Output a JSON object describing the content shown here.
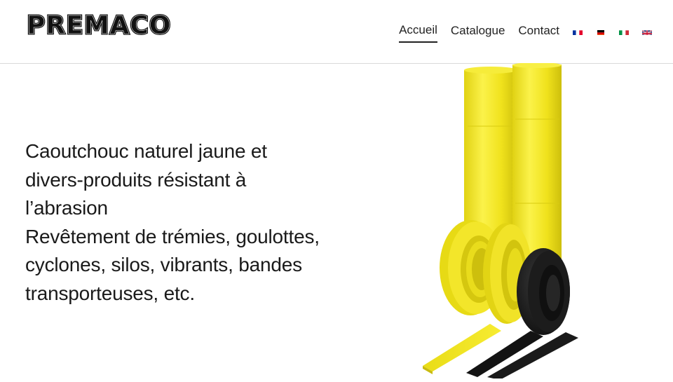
{
  "header": {
    "logo_text": "PREMACO",
    "nav": [
      {
        "label": "Accueil",
        "active": true
      },
      {
        "label": "Catalogue",
        "active": false
      },
      {
        "label": "Contact",
        "active": false
      }
    ],
    "languages": [
      {
        "code": "fr",
        "icon": "flag-fr-icon"
      },
      {
        "code": "de",
        "icon": "flag-de-icon"
      },
      {
        "code": "it",
        "icon": "flag-it-icon"
      },
      {
        "code": "en",
        "icon": "flag-gb-icon"
      }
    ]
  },
  "hero": {
    "lines": [
      "Caoutchouc naturel jaune et",
      "divers-produits résistant à",
      "l’abrasion",
      "Revêtement de trémies, goulottes,",
      "cyclones, silos, vibrants, bandes",
      "transporteuses, etc."
    ],
    "image": "yellow-and-black-rubber-rolls"
  },
  "colors": {
    "rubber_yellow": "#f2e51e",
    "rubber_black": "#151515",
    "text": "#1a1a1a",
    "divider": "#d9d9d9"
  }
}
